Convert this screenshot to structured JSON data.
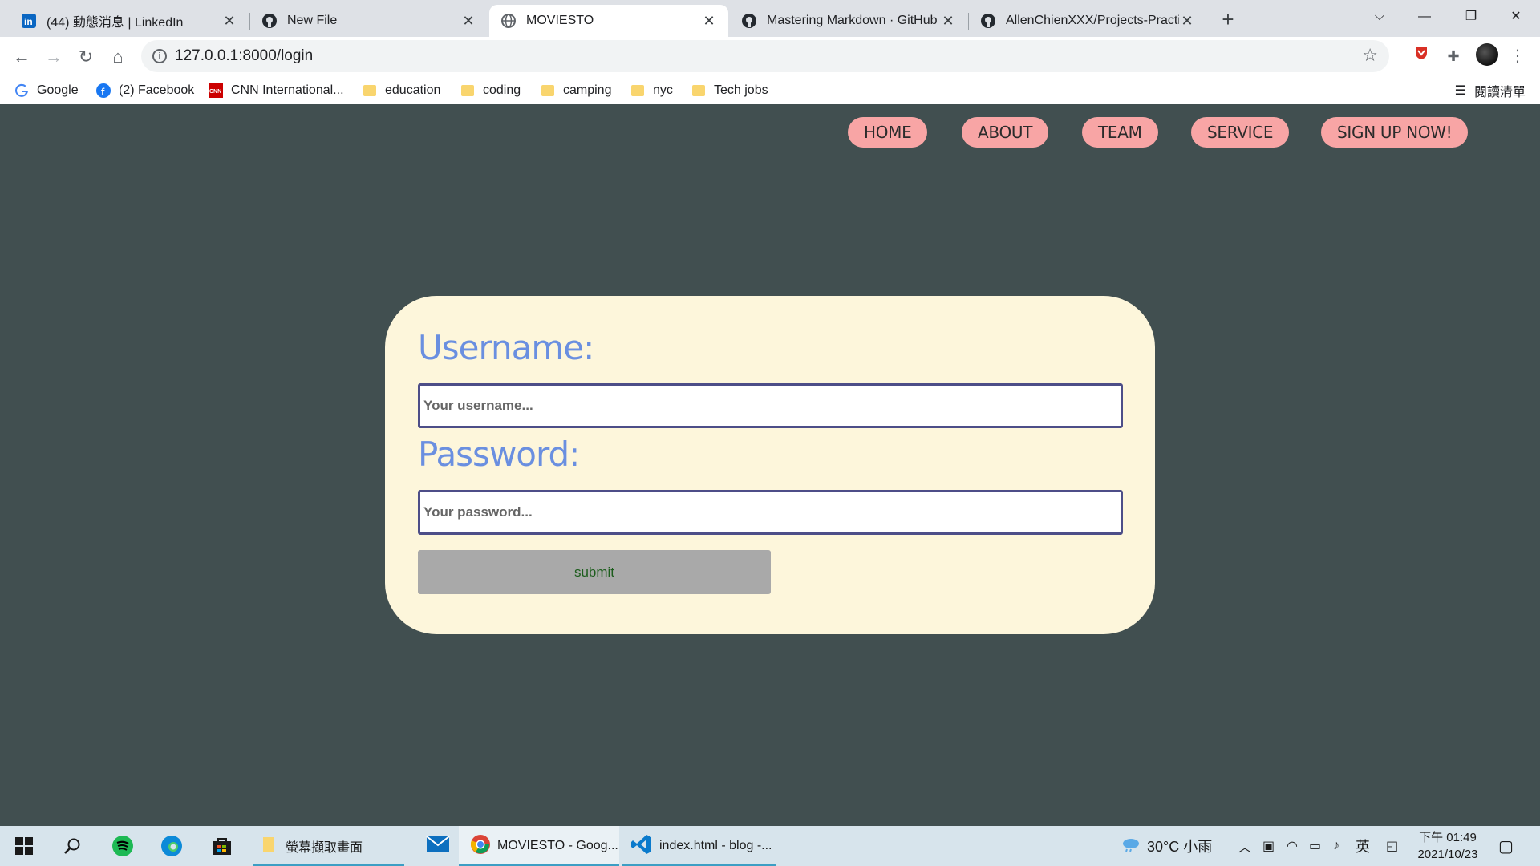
{
  "browser": {
    "tabs": [
      {
        "title": "(44) 動態消息 | LinkedIn",
        "icon": "linkedin-icon",
        "active": false
      },
      {
        "title": "New File",
        "icon": "github-icon",
        "active": false
      },
      {
        "title": "MOVIESTO",
        "icon": "globe-icon",
        "active": true
      },
      {
        "title": "Mastering Markdown · GitHub",
        "icon": "github-icon",
        "active": false
      },
      {
        "title": "AllenChienXXX/Projects-Practic",
        "icon": "github-icon",
        "active": false
      }
    ],
    "url": "127.0.0.1:8000/login",
    "bookmarks": [
      {
        "label": "Google",
        "icon": "google-icon"
      },
      {
        "label": "(2) Facebook",
        "icon": "facebook-icon"
      },
      {
        "label": "CNN International...",
        "icon": "cnn-icon"
      },
      {
        "label": "education",
        "icon": "folder-icon"
      },
      {
        "label": "coding",
        "icon": "folder-icon"
      },
      {
        "label": "camping",
        "icon": "folder-icon"
      },
      {
        "label": "nyc",
        "icon": "folder-icon"
      },
      {
        "label": "Tech jobs",
        "icon": "folder-icon"
      }
    ],
    "reading_list": "閱讀清單"
  },
  "site": {
    "nav": [
      "HOME",
      "ABOUT",
      "TEAM",
      "SERVICE",
      "SIGN UP NOW!"
    ],
    "login": {
      "username_label": "Username:",
      "username_placeholder": "Your username...",
      "password_label": "Password:",
      "password_placeholder": "Your password...",
      "submit_label": "submit"
    },
    "colors": {
      "background": "#414f50",
      "card": "#fdf6db",
      "nav_pill": "#f8a5a5",
      "label": "#6a8fe0",
      "input_border": "#4d4e88",
      "submit_bg": "#a9a9a9",
      "submit_text": "#1d5d1d"
    }
  },
  "taskbar": {
    "apps": [
      {
        "label": "螢幕擷取畫面",
        "icon": "file-explorer-icon"
      },
      {
        "label": "",
        "icon": "mail-icon"
      },
      {
        "label": "MOVIESTO - Goog...",
        "icon": "chrome-icon"
      },
      {
        "label": "index.html - blog -...",
        "icon": "vscode-icon"
      }
    ],
    "weather": "30°C 小雨",
    "ime": "英",
    "time": "下午 01:49",
    "date": "2021/10/23"
  }
}
